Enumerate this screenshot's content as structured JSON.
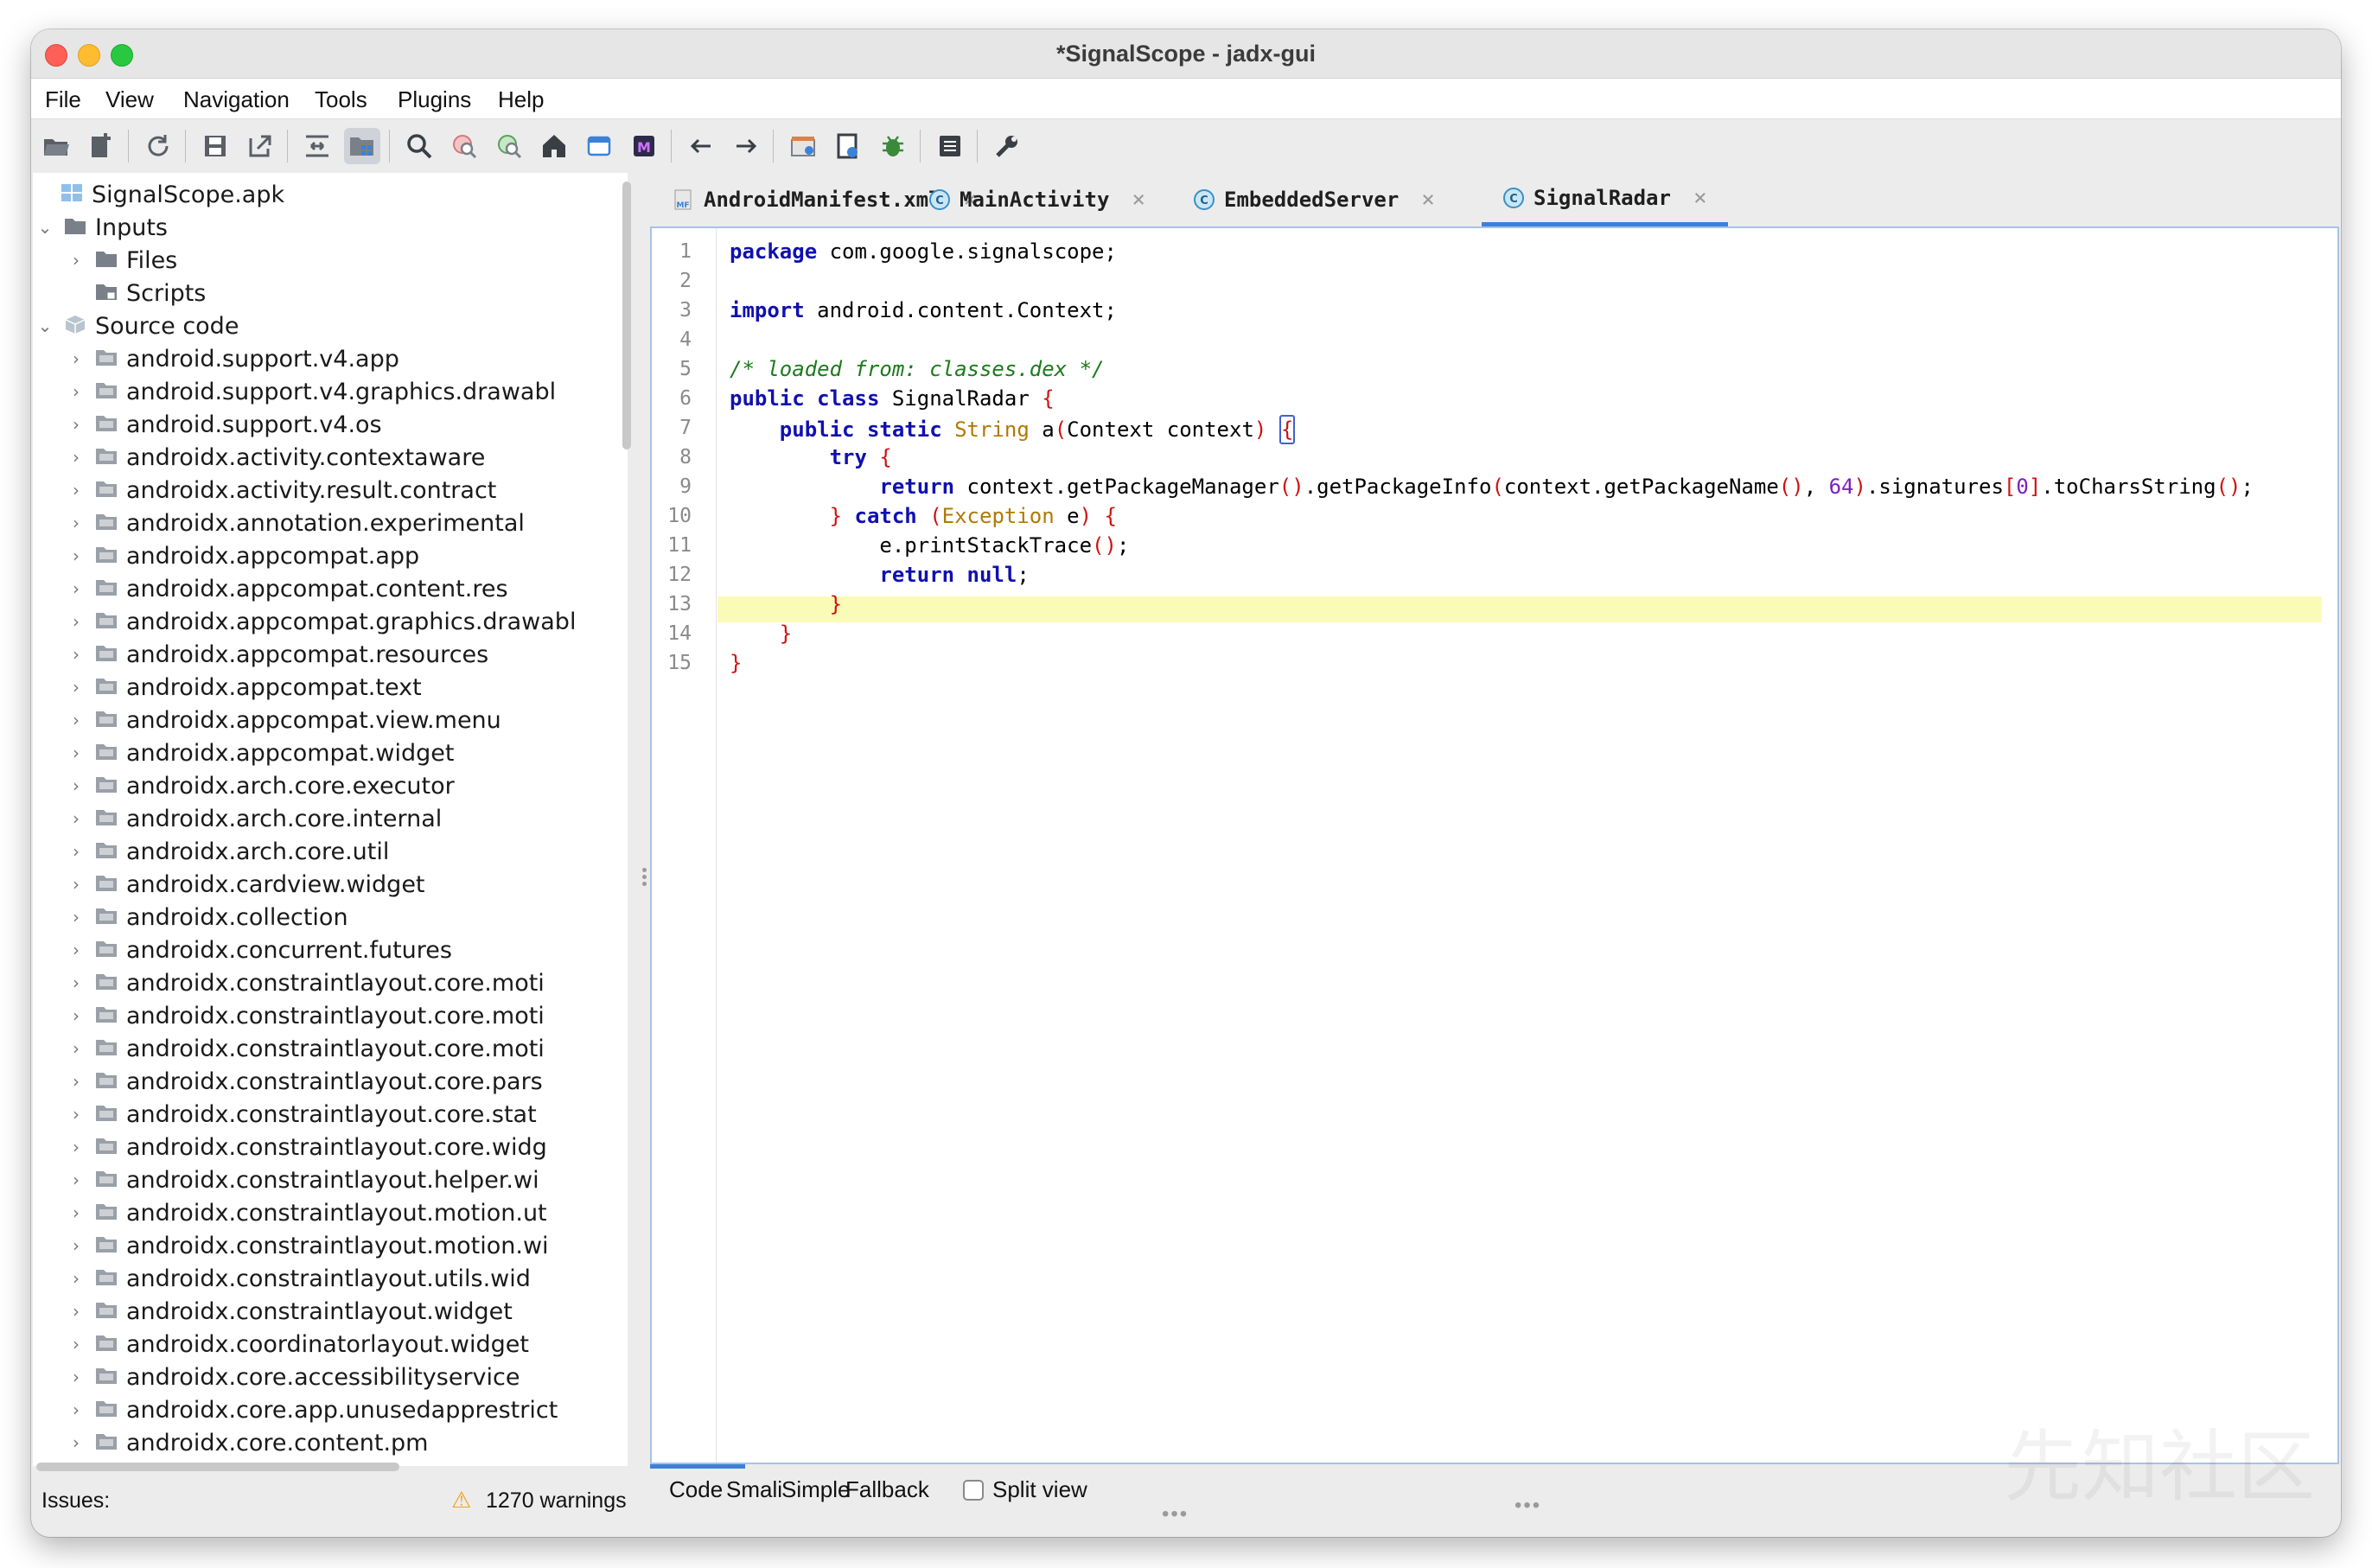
{
  "window": {
    "title": "*SignalScope - jadx-gui"
  },
  "menu": [
    "File",
    "View",
    "Navigation",
    "Tools",
    "Plugins",
    "Help"
  ],
  "toolbar": {
    "icons": [
      "open-file-icon",
      "add-files-icon",
      "reload-icon",
      "save-all-icon",
      "export-icon",
      "sync-tree-icon",
      "flatten-packages-icon",
      "search-icon",
      "find-usage-icon",
      "text-search-icon",
      "home-icon",
      "deobfuscation-icon",
      "mapping-icon",
      "back-icon",
      "forward-icon",
      "quark-icon",
      "decompile-all-icon",
      "debug-icon",
      "log-viewer-icon",
      "settings-icon"
    ]
  },
  "tree": {
    "root": "SignalScope.apk",
    "inputs": "Inputs",
    "files": "Files",
    "scripts": "Scripts",
    "source_code": "Source code",
    "packages": [
      "android.support.v4.app",
      "android.support.v4.graphics.drawabl",
      "android.support.v4.os",
      "androidx.activity.contextaware",
      "androidx.activity.result.contract",
      "androidx.annotation.experimental",
      "androidx.appcompat.app",
      "androidx.appcompat.content.res",
      "androidx.appcompat.graphics.drawabl",
      "androidx.appcompat.resources",
      "androidx.appcompat.text",
      "androidx.appcompat.view.menu",
      "androidx.appcompat.widget",
      "androidx.arch.core.executor",
      "androidx.arch.core.internal",
      "androidx.arch.core.util",
      "androidx.cardview.widget",
      "androidx.collection",
      "androidx.concurrent.futures",
      "androidx.constraintlayout.core.moti",
      "androidx.constraintlayout.core.moti",
      "androidx.constraintlayout.core.moti",
      "androidx.constraintlayout.core.pars",
      "androidx.constraintlayout.core.stat",
      "androidx.constraintlayout.core.widg",
      "androidx.constraintlayout.helper.wi",
      "androidx.constraintlayout.motion.ut",
      "androidx.constraintlayout.motion.wi",
      "androidx.constraintlayout.utils.wid",
      "androidx.constraintlayout.widget",
      "androidx.coordinatorlayout.widget",
      "androidx.core.accessibilityservice",
      "androidx.core.app.unusedapprestrict",
      "androidx.core.content.pm"
    ]
  },
  "status": {
    "issues_label": "Issues:",
    "warnings": "1270 warnings"
  },
  "tabs": [
    {
      "label": "AndroidManifest.xml",
      "icon": "manifest-file-icon",
      "close": "×"
    },
    {
      "label": "MainActivity",
      "icon": "class-icon",
      "close": "×"
    },
    {
      "label": "EmbeddedServer",
      "icon": "class-icon",
      "close": "×"
    },
    {
      "label": "SignalRadar",
      "icon": "class-icon",
      "close": "×",
      "active": true
    }
  ],
  "code": {
    "line_numbers": [
      "1",
      "2",
      "3",
      "4",
      "5",
      "6",
      "7",
      "8",
      "9",
      "10",
      "11",
      "12",
      "13",
      "14",
      "15"
    ],
    "highlighted_line": 14
  },
  "bottom_tabs": {
    "code": "Code",
    "smali": "Smali",
    "simple": "Simple",
    "fallback": "Fallback",
    "split_view": "Split view"
  },
  "watermark": "先知社区",
  "colors": {
    "accent": "#3b82d6",
    "keyword": "#1010b0",
    "comment": "#1c7a1c",
    "highlight": "#fbfbb8",
    "warning": "#f0a020"
  }
}
